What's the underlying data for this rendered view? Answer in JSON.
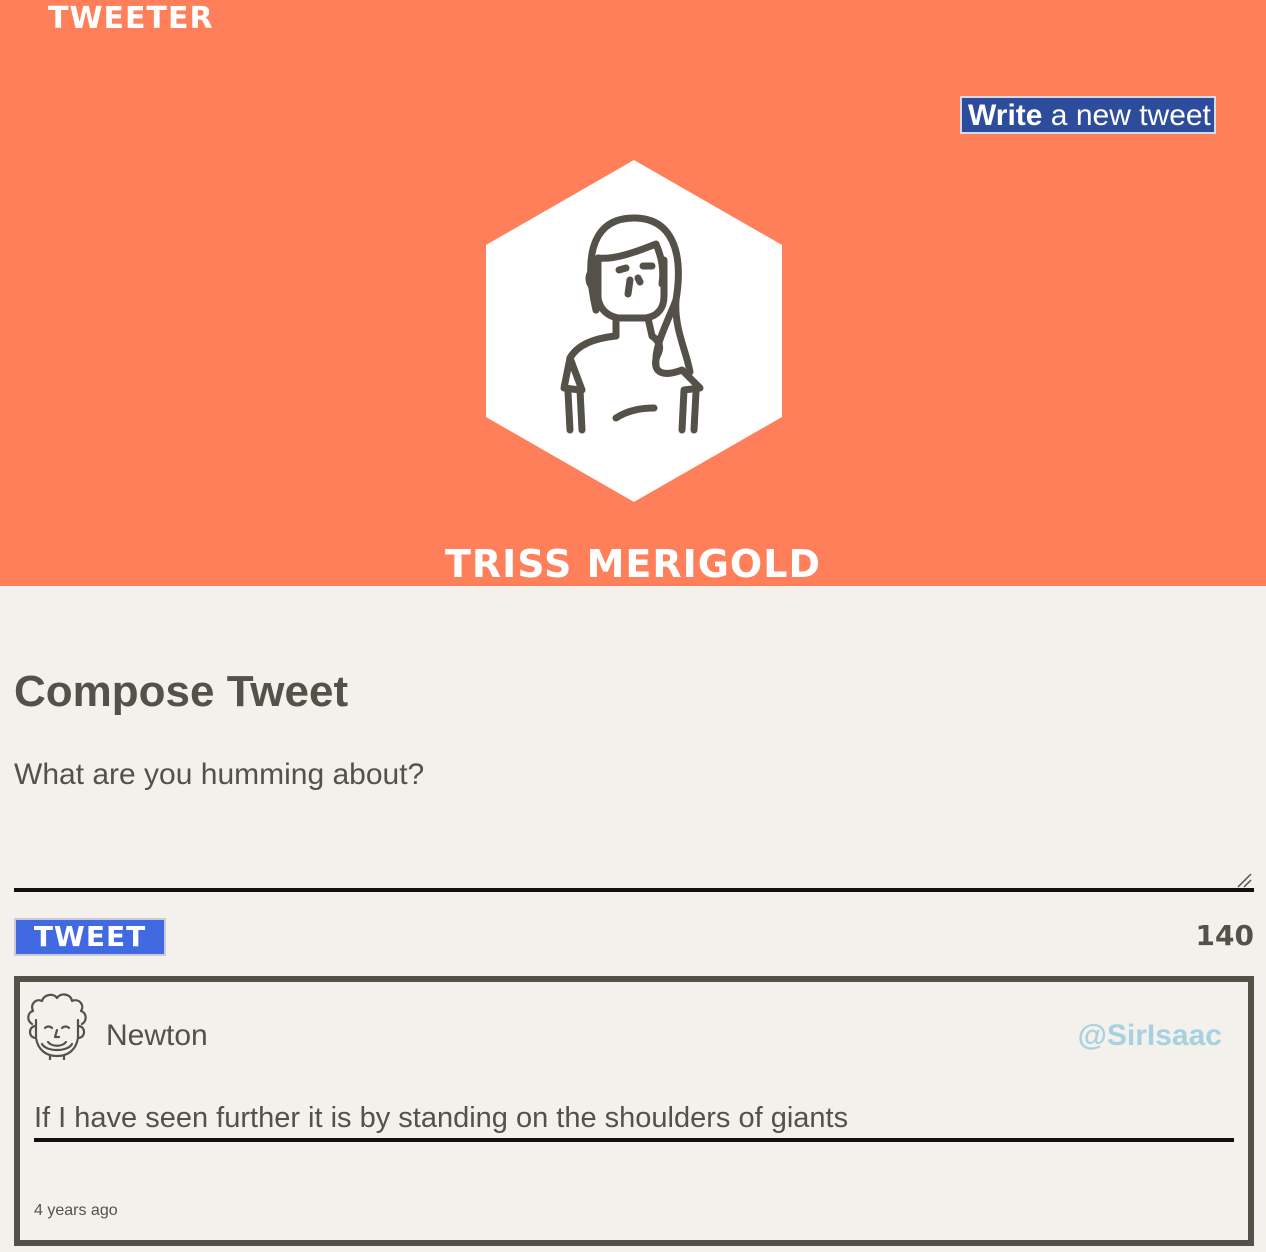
{
  "header": {
    "brand": "TWEETER",
    "write_button": {
      "strong": "Write",
      "rest": " a new tweet"
    },
    "profile_name": "TRISS MERIGOLD",
    "avatar_icon": "woman-avatar-icon",
    "colors": {
      "background": "#fe7f59",
      "button": "#2e4c9c"
    }
  },
  "compose": {
    "title": "Compose Tweet",
    "placeholder": "What are you humming about?",
    "tweet_button": "TWEET",
    "counter": "140",
    "colors": {
      "tweet_button": "#4169e1"
    }
  },
  "tweets": [
    {
      "avatar_icon": "newton-avatar-icon",
      "name": "Newton",
      "handle": "@SirIsaac",
      "text": "If I have seen further it is by standing on the shoulders of giants",
      "time": "4 years ago"
    }
  ],
  "colors": {
    "page_background": "#f4f1ec",
    "text": "#545149",
    "handle": "#a8d1e0"
  }
}
